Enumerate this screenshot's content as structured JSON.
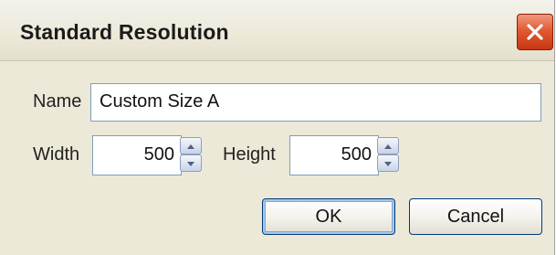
{
  "window": {
    "title": "Standard Resolution",
    "close_icon": "close-icon"
  },
  "form": {
    "name_label": "Name",
    "name_value": "Custom Size A",
    "width_label": "Width",
    "width_value": "500",
    "height_label": "Height",
    "height_value": "500"
  },
  "buttons": {
    "ok_label": "OK",
    "cancel_label": "Cancel"
  },
  "colors": {
    "dialog_bg": "#ece9d8",
    "close_button": "#e05a32",
    "field_border": "#7f9db9",
    "button_border": "#003c74"
  }
}
